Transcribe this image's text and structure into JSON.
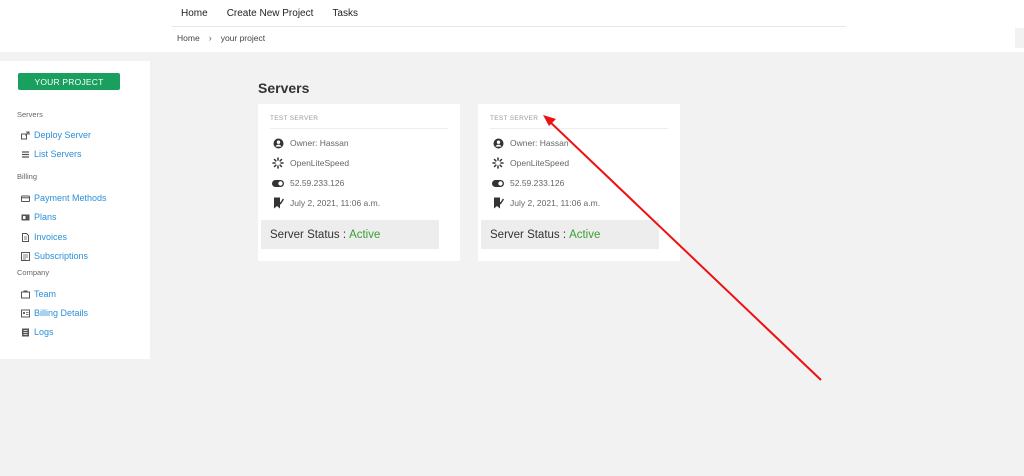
{
  "topnav": [
    "Home",
    "Create New Project",
    "Tasks"
  ],
  "breadcrumb": {
    "home": "Home",
    "sep": "›",
    "current": "your project"
  },
  "sidebar": {
    "project_button": "YOUR PROJECT",
    "sections": [
      {
        "label": "Servers",
        "items": [
          {
            "label": "Deploy Server",
            "icon": "deploy-icon"
          },
          {
            "label": "List Servers",
            "icon": "list-icon"
          }
        ]
      },
      {
        "label": "Billing",
        "items": [
          {
            "label": "Payment Methods",
            "icon": "credit-card-icon"
          },
          {
            "label": "Plans",
            "icon": "plans-icon"
          },
          {
            "label": "Invoices",
            "icon": "invoice-icon"
          },
          {
            "label": "Subscriptions",
            "icon": "subscriptions-icon"
          }
        ]
      },
      {
        "label": "Company",
        "items": [
          {
            "label": "Team",
            "icon": "team-icon"
          },
          {
            "label": "Billing Details",
            "icon": "billing-details-icon"
          },
          {
            "label": "Logs",
            "icon": "logs-icon"
          }
        ]
      }
    ]
  },
  "main": {
    "title": "Servers",
    "servers": [
      {
        "name": "TEST SERVER",
        "owner": "Owner: Hassan",
        "stack": "OpenLiteSpeed",
        "ip": "52.59.233.126",
        "date": "July 2, 2021, 11:06 a.m.",
        "status_label": "Server Status :",
        "status_value": "Active"
      },
      {
        "name": "TEST SERVER",
        "owner": "Owner: Hassan",
        "stack": "OpenLiteSpeed",
        "ip": "52.59.233.126",
        "date": "July 2, 2021, 11:06 a.m.",
        "status_label": "Server Status :",
        "status_value": "Active"
      }
    ]
  },
  "colors": {
    "accent_green": "#1aa05e",
    "link_blue": "#2b8fd9",
    "status_active": "#3aa033",
    "annotation_arrow": "#ee1111"
  }
}
